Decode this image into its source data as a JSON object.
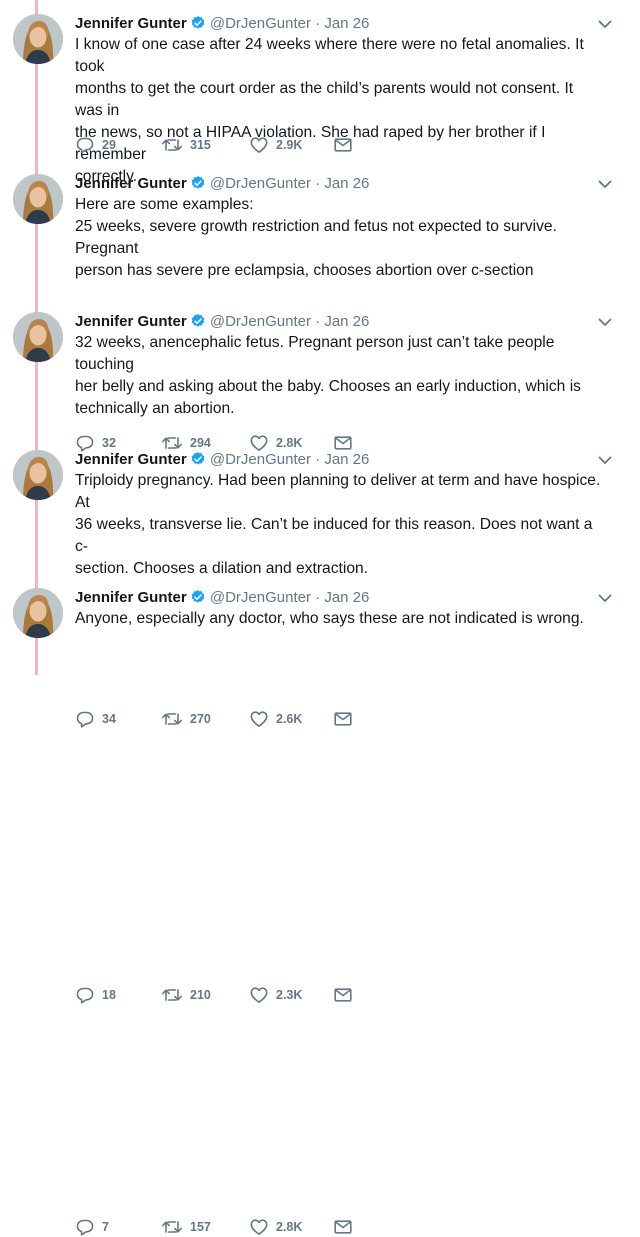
{
  "tweets": [
    {
      "name": "Jennifer Gunter",
      "handle": "@DrJenGunter",
      "separator": "·",
      "date": "Jan 26",
      "text_lines": [
        "I know of one case after 24 weeks where there were no fetal anomalies. It took",
        "months to get the court order as the child’s parents would not consent. It was in",
        "the news, so not a HIPAA violation. She had raped by her brother if I remember",
        "correctly."
      ],
      "replies": "29",
      "retweets": "315",
      "likes": "2.9K"
    },
    {
      "name": "Jennifer Gunter",
      "handle": "@DrJenGunter",
      "separator": "·",
      "date": "Jan 26",
      "text_lines": [
        "Here are some examples:",
        "25 weeks, severe growth restriction and fetus not expected to survive. Pregnant",
        "person has severe pre eclampsia, chooses abortion over c-section"
      ],
      "replies": "32",
      "retweets": "294",
      "likes": "2.8K"
    },
    {
      "name": "Jennifer Gunter",
      "handle": "@DrJenGunter",
      "separator": "·",
      "date": "Jan 26",
      "text_lines": [
        "32 weeks, anencephalic fetus. Pregnant person just can’t take people touching",
        "her belly and asking about the baby. Chooses an early induction, which is",
        "technically an abortion."
      ],
      "replies": "34",
      "retweets": "270",
      "likes": "2.6K"
    },
    {
      "name": "Jennifer Gunter",
      "handle": "@DrJenGunter",
      "separator": "·",
      "date": "Jan 26",
      "text_lines": [
        "Triploidy pregnancy. Had been planning to deliver at term and have hospice. At",
        "36 weeks, transverse lie. Can’t be induced for this reason. Does not want a c-",
        "section. Chooses a dilation and extraction."
      ],
      "replies": "18",
      "retweets": "210",
      "likes": "2.3K"
    },
    {
      "name": "Jennifer Gunter",
      "handle": "@DrJenGunter",
      "separator": "·",
      "date": "Jan 26",
      "text_lines": [
        "Anyone, especially any doctor, who says these are not indicated is wrong."
      ],
      "replies": "7",
      "retweets": "157",
      "likes": "2.8K"
    }
  ],
  "colors": {
    "thread_line": "#f5b3c8",
    "verified": "#1da1f2",
    "muted": "#657786",
    "text": "#14171a"
  },
  "icons": [
    "verified-badge-icon",
    "chevron-down-icon",
    "reply-icon",
    "retweet-icon",
    "like-icon",
    "direct-message-icon"
  ]
}
